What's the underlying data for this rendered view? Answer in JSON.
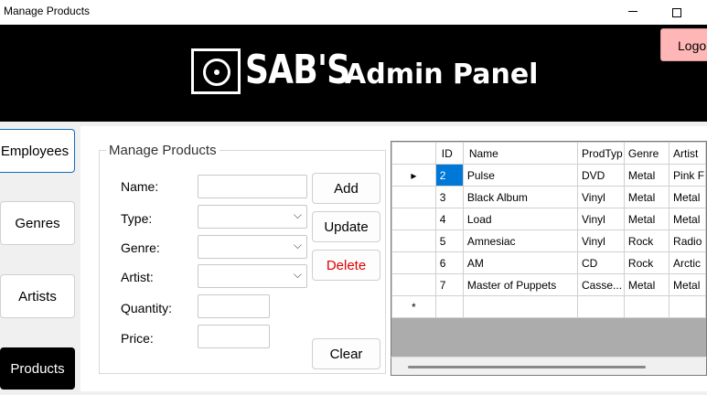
{
  "window": {
    "title": "Manage Products"
  },
  "header": {
    "brand": "SAB'S",
    "panel_title": "Admin Panel",
    "logout_label": "Logo"
  },
  "sidebar": {
    "items": [
      {
        "label": "Employees"
      },
      {
        "label": "Genres"
      },
      {
        "label": "Artists"
      },
      {
        "label": "Products"
      }
    ]
  },
  "form": {
    "group_title": "Manage Products",
    "labels": {
      "name": "Name:",
      "type": "Type:",
      "genre": "Genre:",
      "artist": "Artist:",
      "quantity": "Quantity:",
      "price": "Price:"
    },
    "values": {
      "name": "",
      "type": "",
      "genre": "",
      "artist": "",
      "quantity": "",
      "price": ""
    },
    "buttons": {
      "add": "Add",
      "update": "Update",
      "delete": "Delete",
      "clear": "Clear"
    }
  },
  "grid": {
    "columns": [
      "ID",
      "Name",
      "ProdTyp",
      "Genre",
      "Artist"
    ],
    "rows": [
      [
        "2",
        "Pulse",
        "DVD",
        "Metal",
        "Pink F"
      ],
      [
        "3",
        "Black Album",
        "Vinyl",
        "Metal",
        "Metal"
      ],
      [
        "4",
        "Load",
        "Vinyl",
        "Metal",
        "Metal"
      ],
      [
        "5",
        "Amnesiac",
        "Vinyl",
        "Rock",
        "Radio"
      ],
      [
        "6",
        "AM",
        "CD",
        "Rock",
        "Arctic"
      ],
      [
        "7",
        "Master of Puppets",
        "Casse...",
        "Metal",
        "Metal"
      ]
    ],
    "current_row_marker": "▸",
    "new_row_marker": "*"
  }
}
